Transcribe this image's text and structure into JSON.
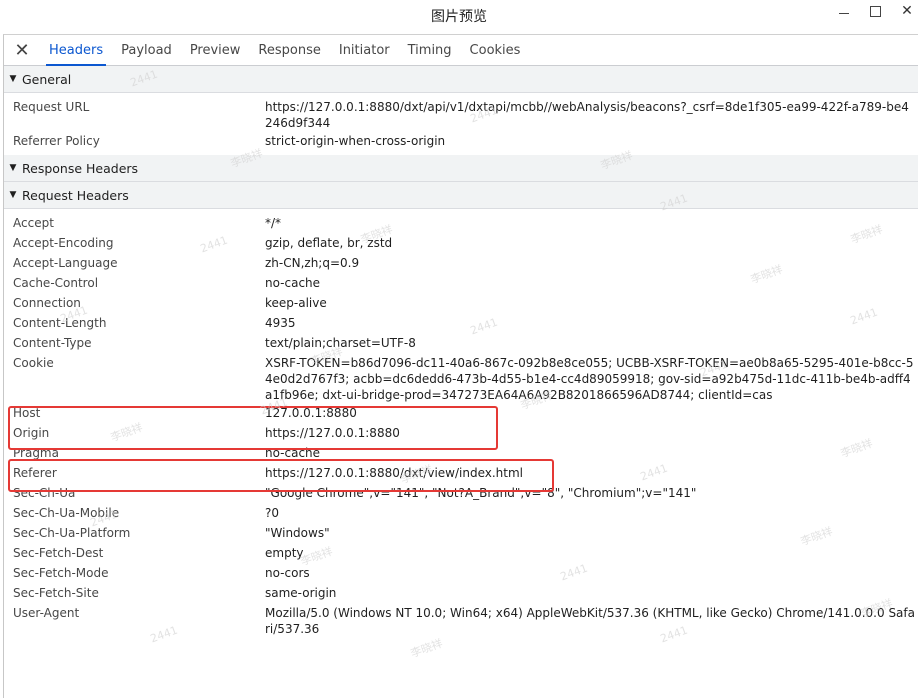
{
  "window": {
    "title": "图片预览"
  },
  "tabs": [
    {
      "label": "Headers",
      "active": true
    },
    {
      "label": "Payload"
    },
    {
      "label": "Preview"
    },
    {
      "label": "Response"
    },
    {
      "label": "Initiator"
    },
    {
      "label": "Timing"
    },
    {
      "label": "Cookies"
    }
  ],
  "general": {
    "title": "General",
    "rows": [
      {
        "key": "Request URL",
        "value": "https://127.0.0.1:8880/dxt/api/v1/dxtapi/mcbb//webAnalysis/beacons?_csrf=8de1f305-ea99-422f-a789-be4246d9f344"
      },
      {
        "key": "Referrer Policy",
        "value": "strict-origin-when-cross-origin"
      }
    ]
  },
  "response_headers": {
    "title": "Response Headers"
  },
  "request_headers": {
    "title": "Request Headers",
    "rows": [
      {
        "key": "Accept",
        "value": "*/*"
      },
      {
        "key": "Accept-Encoding",
        "value": "gzip, deflate, br, zstd"
      },
      {
        "key": "Accept-Language",
        "value": "zh-CN,zh;q=0.9"
      },
      {
        "key": "Cache-Control",
        "value": "no-cache"
      },
      {
        "key": "Connection",
        "value": "keep-alive"
      },
      {
        "key": "Content-Length",
        "value": "4935"
      },
      {
        "key": "Content-Type",
        "value": "text/plain;charset=UTF-8"
      },
      {
        "key": "Cookie",
        "value": "XSRF-TOKEN=b86d7096-dc11-40a6-867c-092b8e8ce055; UCBB-XSRF-TOKEN=ae0b8a65-5295-401e-b8cc-54e0d2d767f3; acbb=dc6dedd6-473b-4d55-b1e4-cc4d89059918; gov-sid=a92b475d-11dc-411b-be4b-adff4a1fb96e; dxt-ui-bridge-prod=347273EA64A6A92B8201866596AD8744; clientId=cas"
      },
      {
        "key": "Host",
        "value": "127.0.0.1:8880"
      },
      {
        "key": "Origin",
        "value": "https://127.0.0.1:8880"
      },
      {
        "key": "Pragma",
        "value": "no-cache"
      },
      {
        "key": "Referer",
        "value": "https://127.0.0.1:8880/dxt/view/index.html"
      },
      {
        "key": "Sec-Ch-Ua",
        "value": "\"Google Chrome\";v=\"141\", \"Not?A_Brand\";v=\"8\", \"Chromium\";v=\"141\""
      },
      {
        "key": "Sec-Ch-Ua-Mobile",
        "value": "?0"
      },
      {
        "key": "Sec-Ch-Ua-Platform",
        "value": "\"Windows\""
      },
      {
        "key": "Sec-Fetch-Dest",
        "value": "empty"
      },
      {
        "key": "Sec-Fetch-Mode",
        "value": "no-cors"
      },
      {
        "key": "Sec-Fetch-Site",
        "value": "same-origin"
      },
      {
        "key": "User-Agent",
        "value": "Mozilla/5.0 (Windows NT 10.0; Win64; x64) AppleWebKit/537.36 (KHTML, like Gecko) Chrome/141.0.0.0 Safari/537.36"
      }
    ]
  },
  "watermark": {
    "number": "2441",
    "name": "李晓祥"
  },
  "colors": {
    "accent": "#0b57d0",
    "highlight": "#e53935"
  }
}
